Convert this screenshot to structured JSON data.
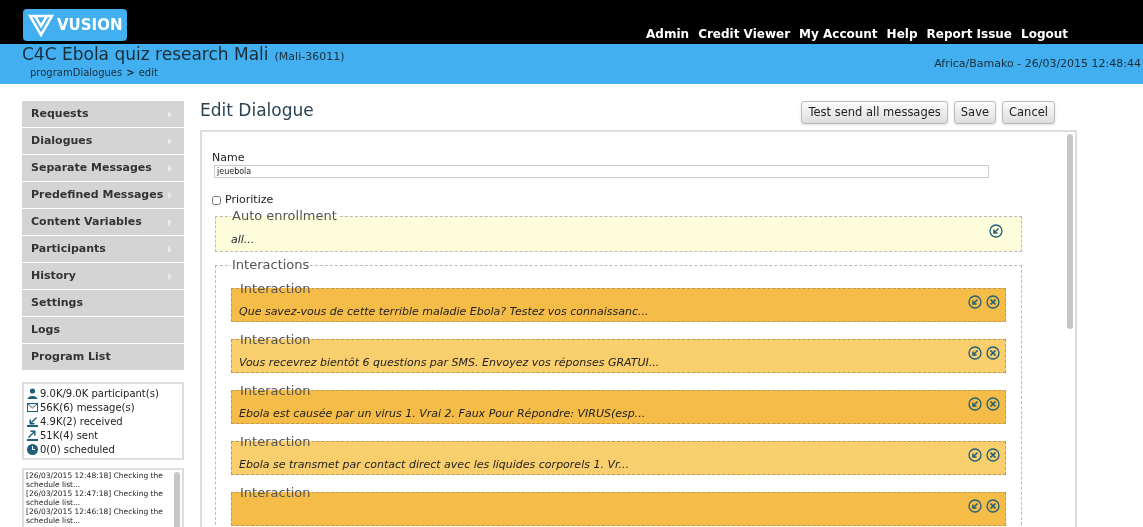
{
  "header": {
    "logo": "VUSION",
    "nav": [
      "Admin",
      "Credit Viewer",
      "My Account",
      "Help",
      "Report Issue",
      "Logout"
    ]
  },
  "program": {
    "title": "C4C Ebola quiz research Mali",
    "code": "(Mali-36011)",
    "breadcrumb": [
      "programDialogues",
      "edit"
    ],
    "separator": ">",
    "timezone": "Africa/Bamako - 26/03/2015 12:48:44"
  },
  "sidebar": {
    "items": [
      {
        "label": "Requests",
        "submenu": true
      },
      {
        "label": "Dialogues",
        "submenu": true
      },
      {
        "label": "Separate Messages",
        "submenu": true
      },
      {
        "label": "Predefined Messages",
        "submenu": true
      },
      {
        "label": "Content Variables",
        "submenu": true
      },
      {
        "label": "Participants",
        "submenu": true
      },
      {
        "label": "History",
        "submenu": true
      },
      {
        "label": "Settings",
        "submenu": false
      },
      {
        "label": "Logs",
        "submenu": false
      },
      {
        "label": "Program List",
        "submenu": false
      }
    ],
    "stats": [
      {
        "kind": "participants",
        "text": "9.0K/9.0K participant(s)"
      },
      {
        "kind": "messages",
        "text": "56K(6) message(s)"
      },
      {
        "kind": "received",
        "text": "4.9K(2) received"
      },
      {
        "kind": "sent",
        "text": "51K(4) sent"
      },
      {
        "kind": "scheduled",
        "text": "0(0) scheduled"
      }
    ],
    "log": [
      "[26/03/2015 12:48:18] Checking the schedule list...",
      "[26/03/2015 12:47:18] Checking the schedule list...",
      "[26/03/2015 12:46:18] Checking the schedule list..."
    ]
  },
  "main": {
    "title": "Edit Dialogue",
    "buttons": [
      "Test send all messages",
      "Save",
      "Cancel"
    ],
    "name_label": "Name",
    "name_value": "jeuebola",
    "prioritize": {
      "label": "Prioritize",
      "checked": false
    },
    "auto_enrollment": {
      "legend": "Auto enrollment",
      "value": "all..."
    },
    "interactions_legend": "Interactions",
    "interactions": [
      {
        "legend": "Interaction",
        "message": "Que savez-vous de cette terrible maladie Ebola? Testez vos connaissanc...",
        "color": "#f5bd47"
      },
      {
        "legend": "Interaction",
        "message": "Vous recevrez bientôt 6 questions par SMS. Envoyez vos réponses GRATUI...",
        "color": "#f9cf6e"
      },
      {
        "legend": "Interaction",
        "message": "Ebola est causée par un virus 1. Vrai 2. Faux Pour Répondre: VIRUS(esp...",
        "color": "#f5bd47"
      },
      {
        "legend": "Interaction",
        "message": "Ebola se transmet par contact direct avec les liquides corporels 1. Vr...",
        "color": "#f9cf6e"
      },
      {
        "legend": "Interaction",
        "color": "#f5bd47"
      }
    ]
  }
}
